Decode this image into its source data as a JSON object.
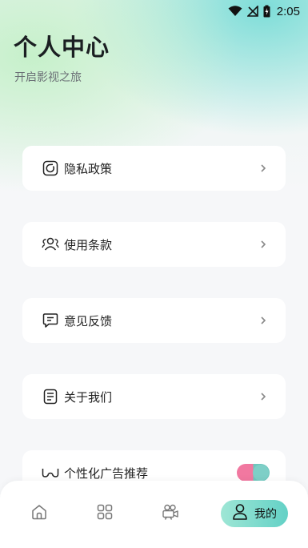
{
  "status_bar": {
    "time": "2:05"
  },
  "header": {
    "title": "个人中心",
    "subtitle": "开启影视之旅"
  },
  "menu": {
    "items": [
      {
        "label": "隐私政策",
        "icon": "privacy-icon"
      },
      {
        "label": "使用条款",
        "icon": "users-icon"
      },
      {
        "label": "意见反馈",
        "icon": "feedback-icon"
      },
      {
        "label": "关于我们",
        "icon": "document-icon"
      },
      {
        "label": "个性化广告推荐",
        "icon": "glasses-icon",
        "toggle_on": true
      }
    ]
  },
  "tabbar": {
    "tabs": [
      {
        "icon": "home-icon",
        "label": ""
      },
      {
        "icon": "grid-icon",
        "label": ""
      },
      {
        "icon": "video-camera-icon",
        "label": ""
      },
      {
        "icon": "person-icon",
        "label": "我的",
        "active": true
      }
    ]
  },
  "colors": {
    "accent": "#63d1c6",
    "toggle_pink": "#f178a0",
    "background": "#f6f7f9"
  }
}
